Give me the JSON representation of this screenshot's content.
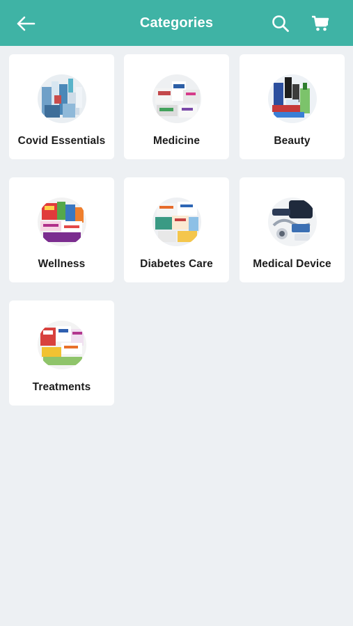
{
  "header": {
    "title": "Categories",
    "back_icon": "arrow-left-icon",
    "search_icon": "search-icon",
    "cart_icon": "cart-icon",
    "color": "#3fb3a5"
  },
  "categories": [
    {
      "label": "Covid Essentials",
      "icon": "covid-essentials-products-image"
    },
    {
      "label": "Medicine",
      "icon": "medicine-products-image"
    },
    {
      "label": "Beauty",
      "icon": "beauty-products-image"
    },
    {
      "label": "Wellness",
      "icon": "wellness-products-image"
    },
    {
      "label": "Diabetes Care",
      "icon": "diabetes-care-products-image"
    },
    {
      "label": "Medical Device",
      "icon": "medical-device-products-image"
    },
    {
      "label": "Treatments",
      "icon": "treatments-products-image"
    }
  ]
}
